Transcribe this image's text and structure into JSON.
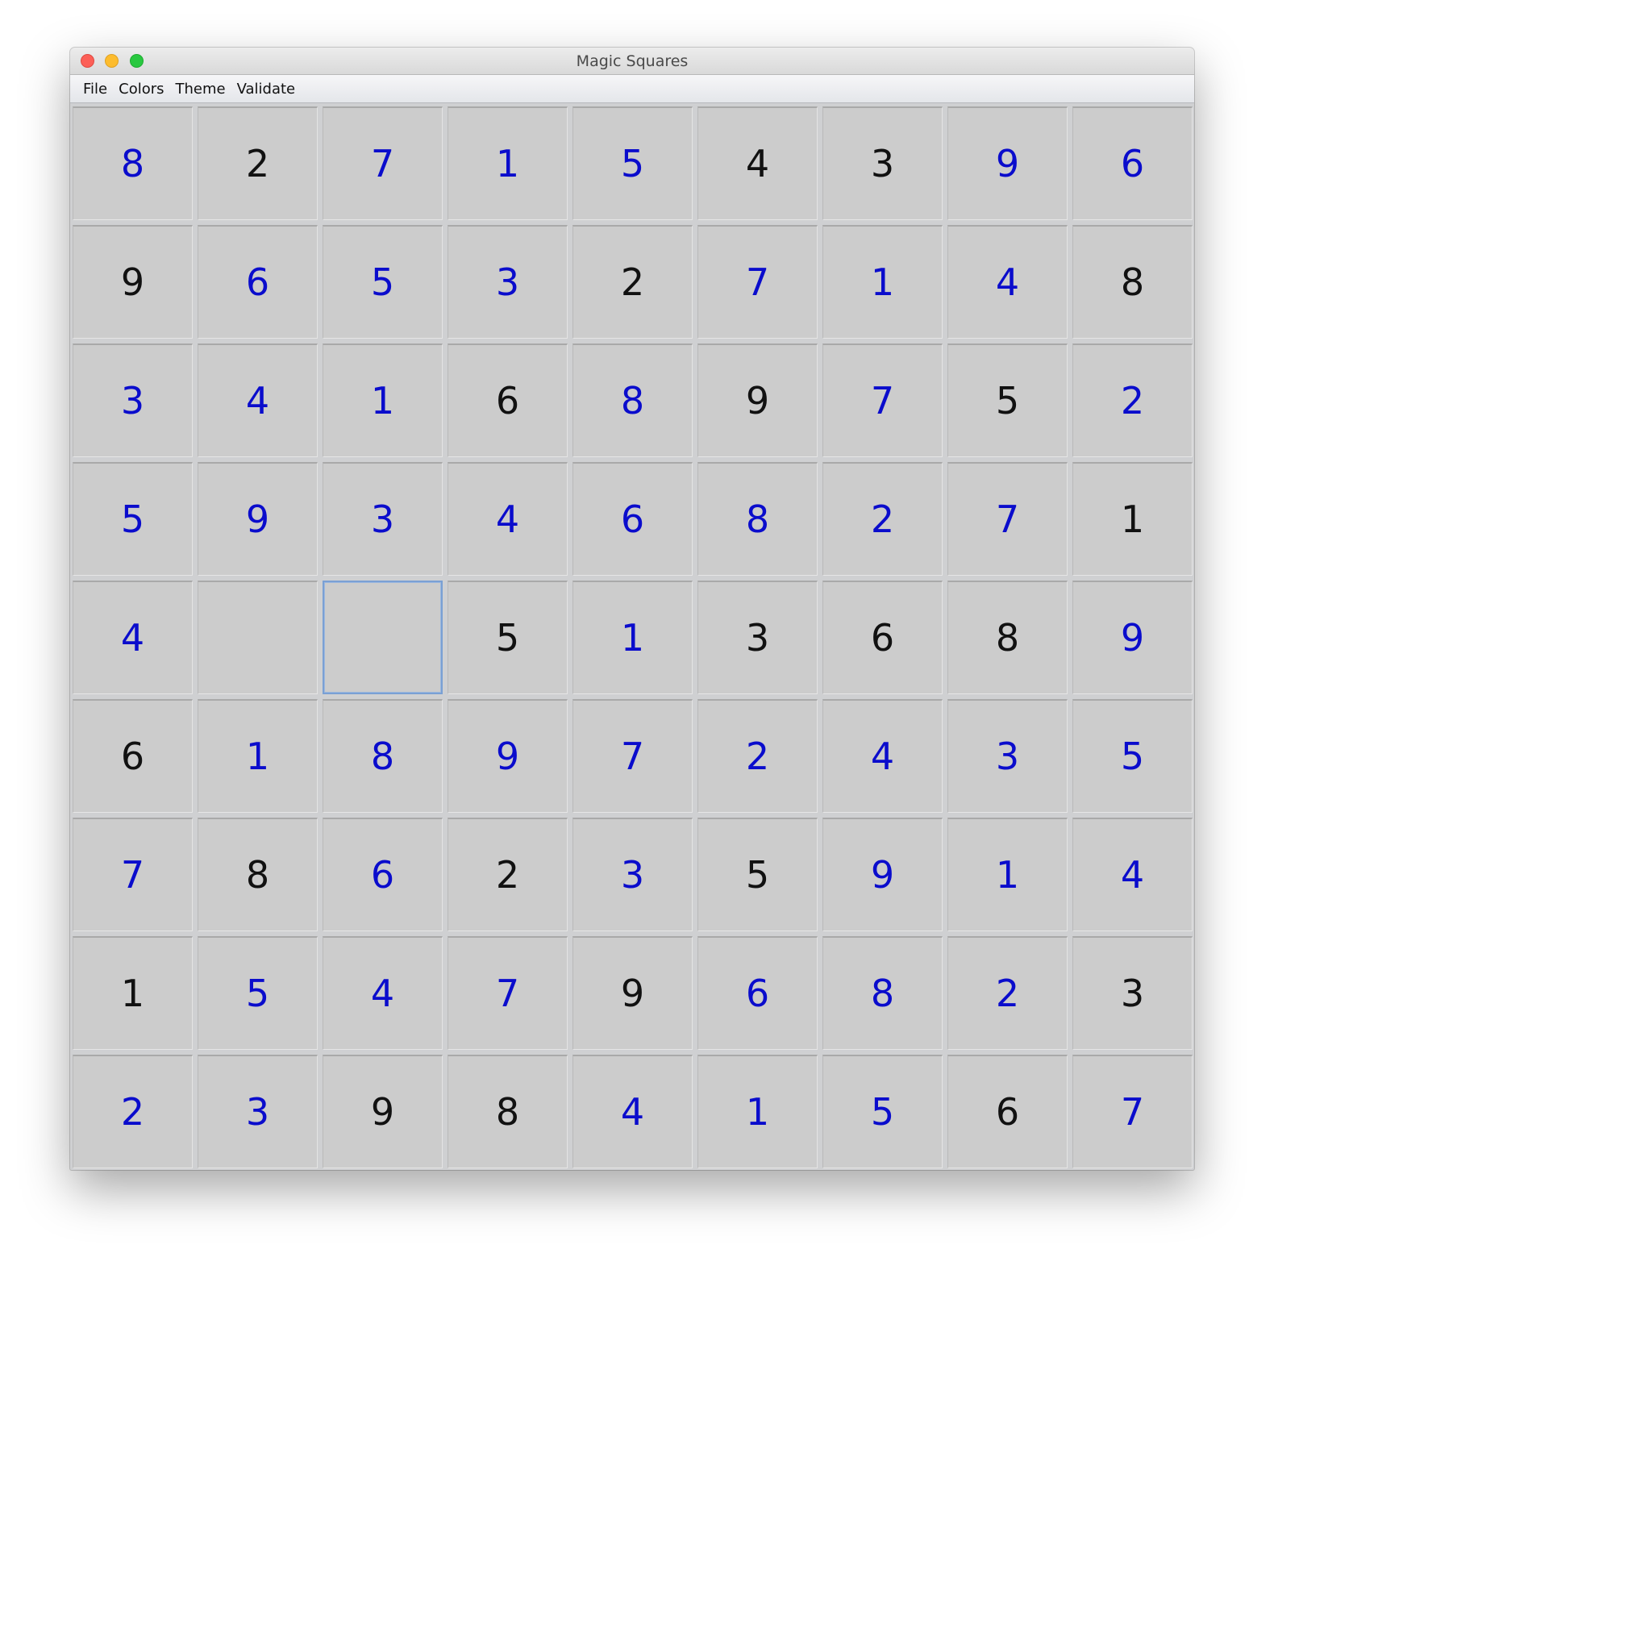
{
  "window": {
    "title": "Magic Squares",
    "traffic_lights": [
      "close-button",
      "minimize-button",
      "zoom-button"
    ]
  },
  "menu": [
    "File",
    "Colors",
    "Theme",
    "Validate"
  ],
  "colors": {
    "given": "#111111",
    "entered": "#0a0ccc",
    "cell_background": "#cccccc",
    "focus_ring": "#7aa0d4"
  },
  "board": {
    "size": 9,
    "focused_cell": [
      4,
      2
    ],
    "rows": [
      [
        {
          "v": "8",
          "e": true
        },
        {
          "v": "2",
          "e": false
        },
        {
          "v": "7",
          "e": true
        },
        {
          "v": "1",
          "e": true
        },
        {
          "v": "5",
          "e": true
        },
        {
          "v": "4",
          "e": false
        },
        {
          "v": "3",
          "e": false
        },
        {
          "v": "9",
          "e": true
        },
        {
          "v": "6",
          "e": true
        }
      ],
      [
        {
          "v": "9",
          "e": false
        },
        {
          "v": "6",
          "e": true
        },
        {
          "v": "5",
          "e": true
        },
        {
          "v": "3",
          "e": true
        },
        {
          "v": "2",
          "e": false
        },
        {
          "v": "7",
          "e": true
        },
        {
          "v": "1",
          "e": true
        },
        {
          "v": "4",
          "e": true
        },
        {
          "v": "8",
          "e": false
        }
      ],
      [
        {
          "v": "3",
          "e": true
        },
        {
          "v": "4",
          "e": true
        },
        {
          "v": "1",
          "e": true
        },
        {
          "v": "6",
          "e": false
        },
        {
          "v": "8",
          "e": true
        },
        {
          "v": "9",
          "e": false
        },
        {
          "v": "7",
          "e": true
        },
        {
          "v": "5",
          "e": false
        },
        {
          "v": "2",
          "e": true
        }
      ],
      [
        {
          "v": "5",
          "e": true
        },
        {
          "v": "9",
          "e": true
        },
        {
          "v": "3",
          "e": true
        },
        {
          "v": "4",
          "e": true
        },
        {
          "v": "6",
          "e": true
        },
        {
          "v": "8",
          "e": true
        },
        {
          "v": "2",
          "e": true
        },
        {
          "v": "7",
          "e": true
        },
        {
          "v": "1",
          "e": false
        }
      ],
      [
        {
          "v": "4",
          "e": true
        },
        {
          "v": "",
          "e": true
        },
        {
          "v": "",
          "e": true
        },
        {
          "v": "5",
          "e": false
        },
        {
          "v": "1",
          "e": true
        },
        {
          "v": "3",
          "e": false
        },
        {
          "v": "6",
          "e": false
        },
        {
          "v": "8",
          "e": false
        },
        {
          "v": "9",
          "e": true
        }
      ],
      [
        {
          "v": "6",
          "e": false
        },
        {
          "v": "1",
          "e": true
        },
        {
          "v": "8",
          "e": true
        },
        {
          "v": "9",
          "e": true
        },
        {
          "v": "7",
          "e": true
        },
        {
          "v": "2",
          "e": true
        },
        {
          "v": "4",
          "e": true
        },
        {
          "v": "3",
          "e": true
        },
        {
          "v": "5",
          "e": true
        }
      ],
      [
        {
          "v": "7",
          "e": true
        },
        {
          "v": "8",
          "e": false
        },
        {
          "v": "6",
          "e": true
        },
        {
          "v": "2",
          "e": false
        },
        {
          "v": "3",
          "e": true
        },
        {
          "v": "5",
          "e": false
        },
        {
          "v": "9",
          "e": true
        },
        {
          "v": "1",
          "e": true
        },
        {
          "v": "4",
          "e": true
        }
      ],
      [
        {
          "v": "1",
          "e": false
        },
        {
          "v": "5",
          "e": true
        },
        {
          "v": "4",
          "e": true
        },
        {
          "v": "7",
          "e": true
        },
        {
          "v": "9",
          "e": false
        },
        {
          "v": "6",
          "e": true
        },
        {
          "v": "8",
          "e": true
        },
        {
          "v": "2",
          "e": true
        },
        {
          "v": "3",
          "e": false
        }
      ],
      [
        {
          "v": "2",
          "e": true
        },
        {
          "v": "3",
          "e": true
        },
        {
          "v": "9",
          "e": false
        },
        {
          "v": "8",
          "e": false
        },
        {
          "v": "4",
          "e": true
        },
        {
          "v": "1",
          "e": true
        },
        {
          "v": "5",
          "e": true
        },
        {
          "v": "6",
          "e": false
        },
        {
          "v": "7",
          "e": true
        }
      ]
    ]
  }
}
